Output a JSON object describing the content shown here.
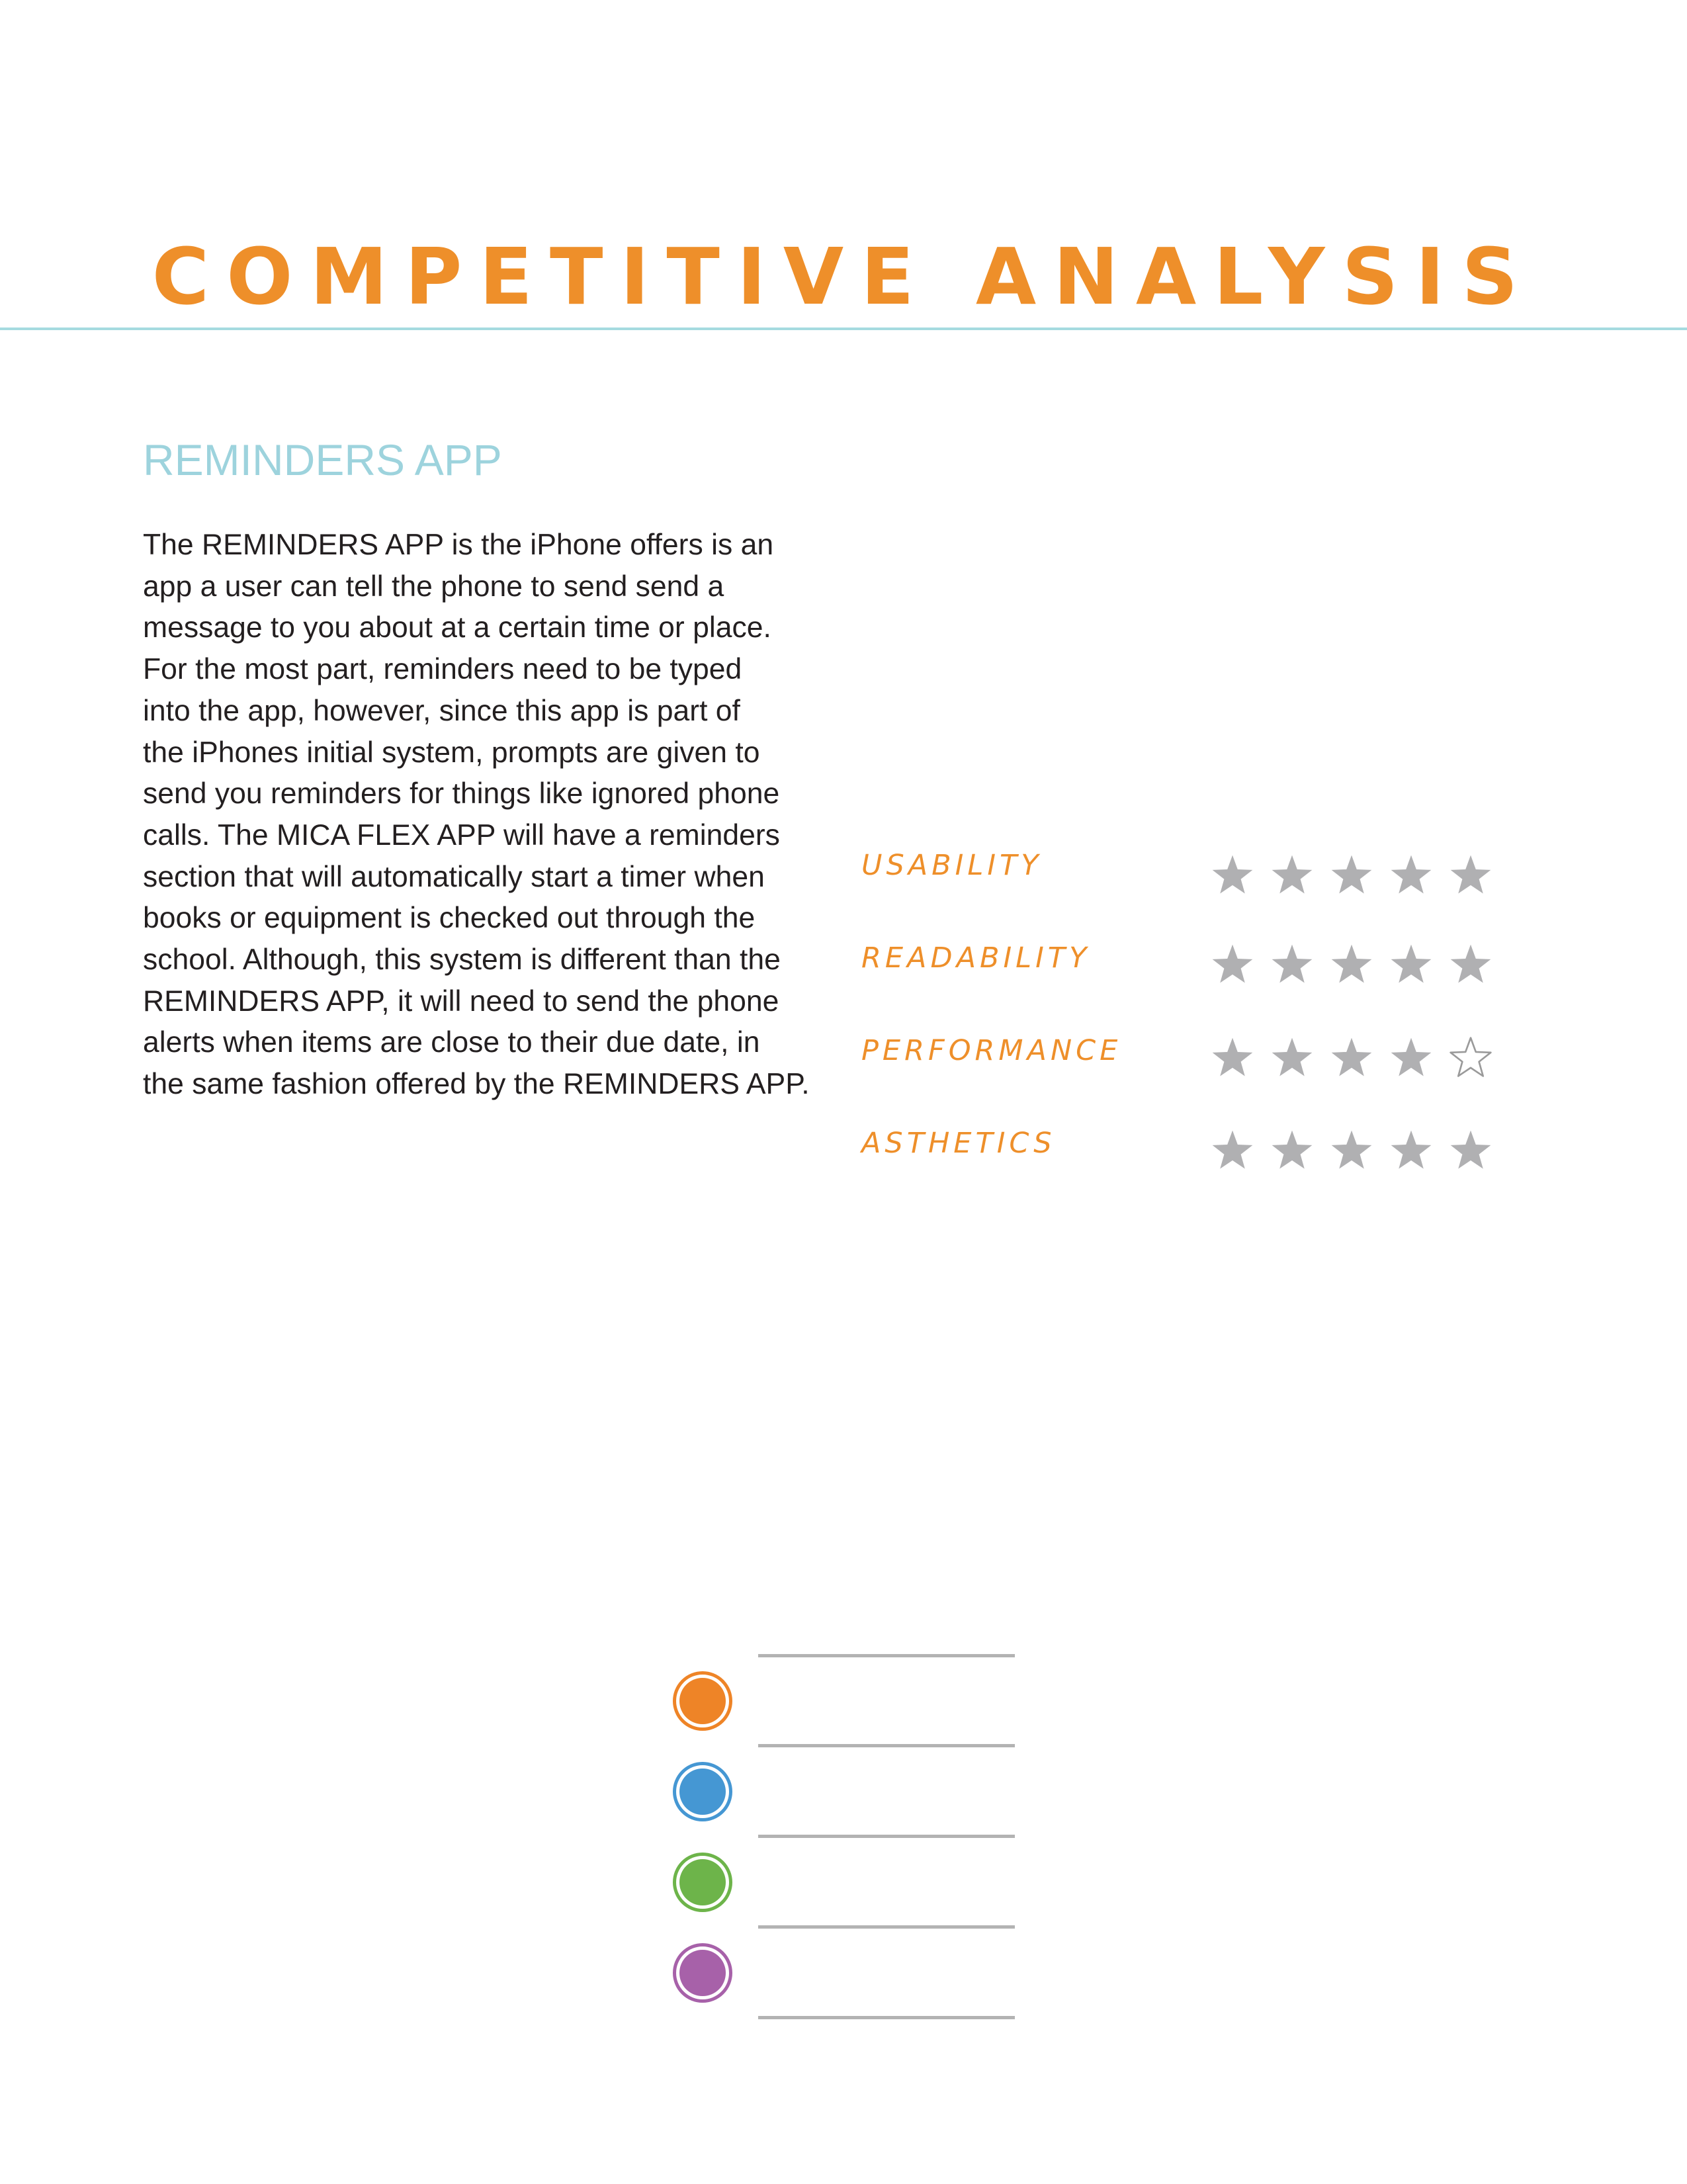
{
  "header": {
    "title": "COMPETITIVE ANALYSIS"
  },
  "section": {
    "heading": "REMINDERS APP",
    "body_lines": [
      "The REMINDERS APP is the iPhone offers is an",
      "app a user can tell the phone to send send a",
      "message to you about at a certain time or place.",
      "For the most part, reminders need to be typed",
      "into the app, however, since this app is part of",
      "the iPhones initial system, prompts are given to",
      "send you reminders for things like ignored phone",
      "calls. The MICA FLEX APP will have a reminders",
      "section that will automatically start a timer when",
      "books or equipment is checked out through the",
      "school. Although, this system is different than the",
      "REMINDERS APP, it will need to send the phone",
      "alerts when items are close to their due date, in",
      "the same fashion offered by the REMINDERS APP."
    ]
  },
  "ratings": [
    {
      "label": "USABILITY",
      "stars": 5,
      "max": 5
    },
    {
      "label": "READABILITY",
      "stars": 5,
      "max": 5
    },
    {
      "label": "PERFORMANCE",
      "stars": 4,
      "max": 5
    },
    {
      "label": "ASTHETICS",
      "stars": 5,
      "max": 5
    }
  ],
  "legend": {
    "colors": [
      "#ee8427",
      "#4597d3",
      "#6db44a",
      "#a761a9"
    ]
  },
  "colors": {
    "title": "#ee8f2a",
    "heading": "#9dd3dd",
    "rule": "#a5dbe0",
    "star_filled": "#b0b0b2",
    "star_outline": "#9a9a9a"
  }
}
